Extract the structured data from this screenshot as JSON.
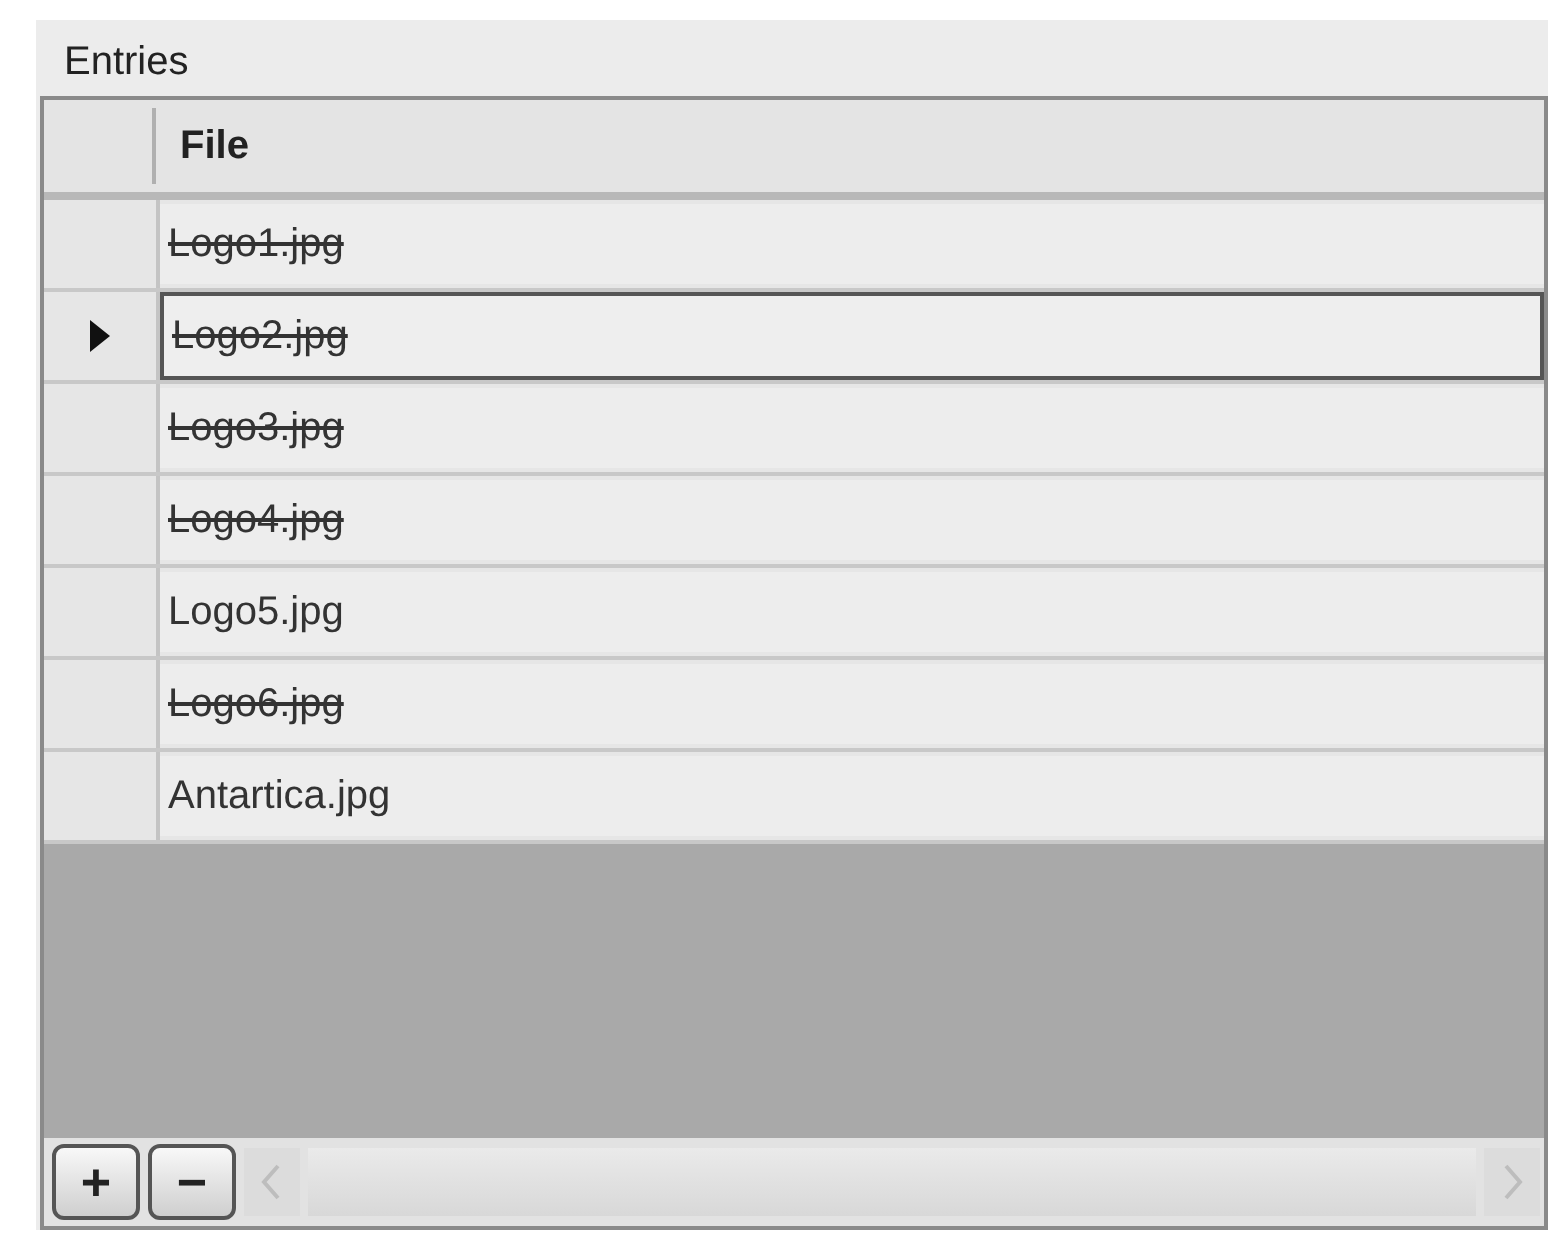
{
  "group": {
    "title": "Entries"
  },
  "table": {
    "columns": [
      "File"
    ],
    "rows": [
      {
        "file": "Logo1.jpg",
        "struck": true,
        "selected": false
      },
      {
        "file": "Logo2.jpg",
        "struck": true,
        "selected": true
      },
      {
        "file": "Logo3.jpg",
        "struck": true,
        "selected": false
      },
      {
        "file": "Logo4.jpg",
        "struck": true,
        "selected": false
      },
      {
        "file": "Logo5.jpg",
        "struck": false,
        "selected": false
      },
      {
        "file": "Logo6.jpg",
        "struck": true,
        "selected": false
      },
      {
        "file": "Antartica.jpg",
        "struck": false,
        "selected": false
      }
    ]
  },
  "toolbar": {
    "buttons": [
      "+",
      "−"
    ]
  }
}
